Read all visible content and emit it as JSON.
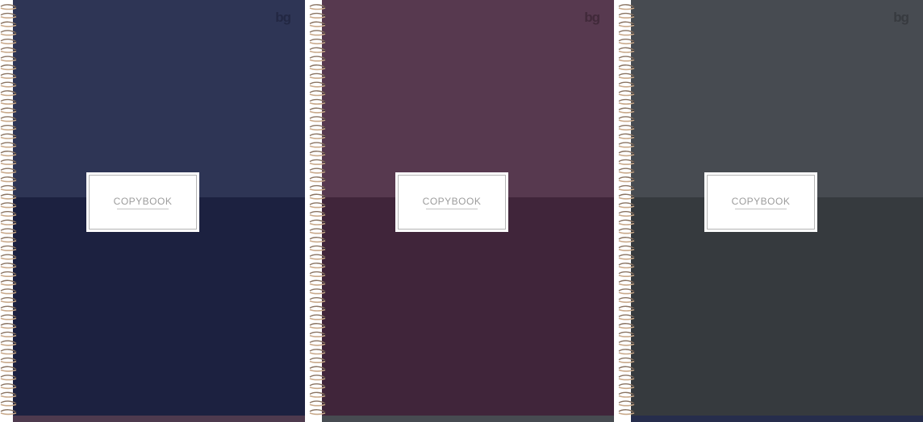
{
  "notebooks": [
    {
      "label": "COPYBOOK",
      "logo": "bg",
      "colors": {
        "top": "#2e3555",
        "bottom": "#1c2140",
        "strip": "#4e3a4e",
        "logo": "#1a1d33"
      }
    },
    {
      "label": "COPYBOOK",
      "logo": "bg",
      "colors": {
        "top": "#57394f",
        "bottom": "#40253a",
        "strip": "#474b51",
        "logo": "#2e1c28"
      }
    },
    {
      "label": "COPYBOOK",
      "logo": "bg",
      "colors": {
        "top": "#474b51",
        "bottom": "#363a3e",
        "strip": "#262d4c",
        "logo": "#2a2d31"
      }
    }
  ],
  "spiral_color": "#c9a98a"
}
